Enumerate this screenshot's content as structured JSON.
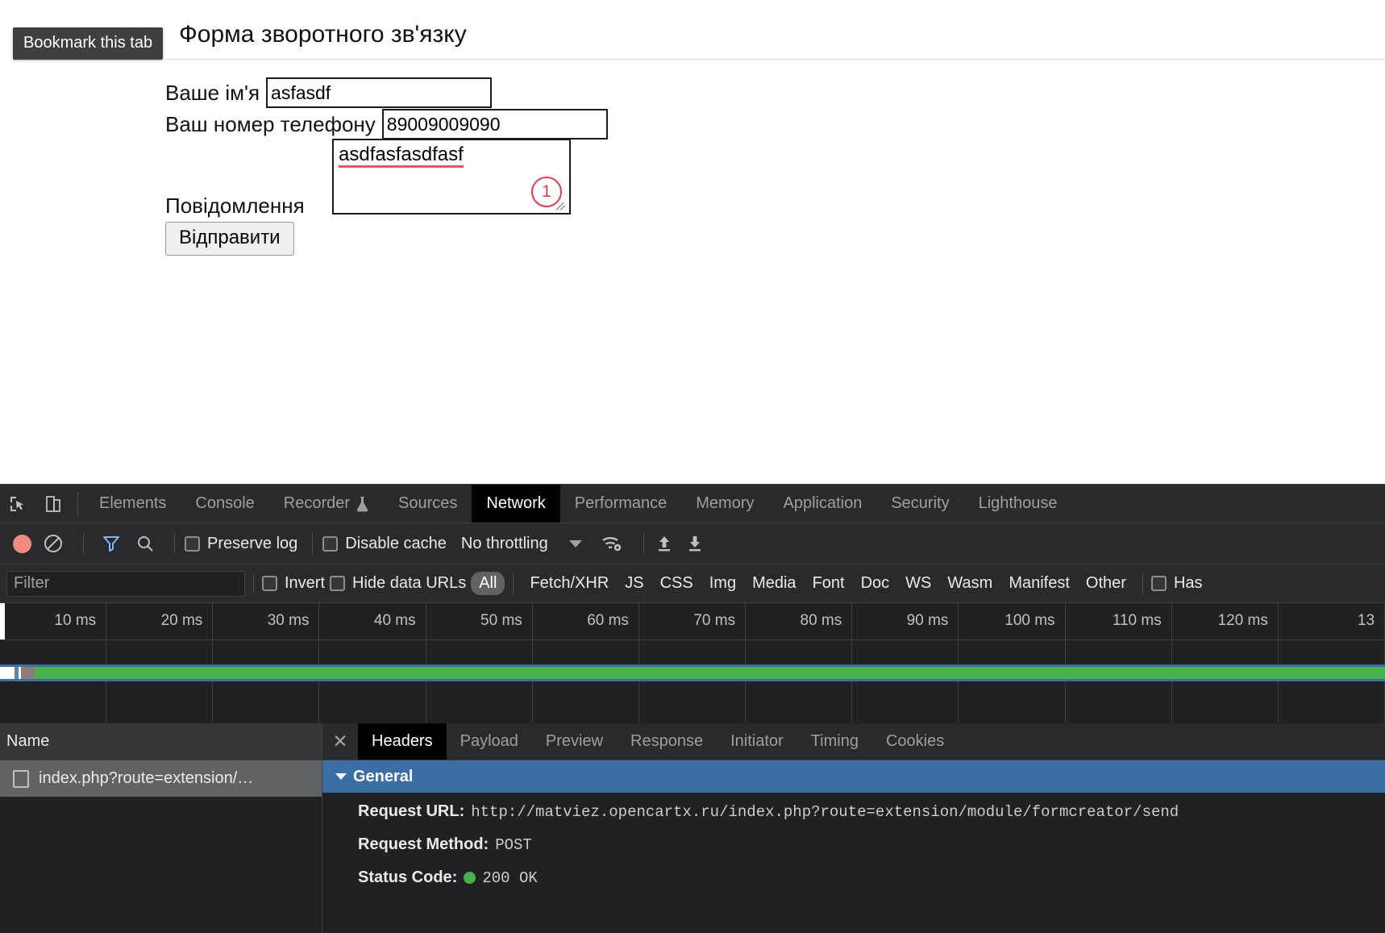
{
  "browser": {
    "tooltip": "Bookmark this tab"
  },
  "page": {
    "title": "Форма зворотного зв'язку",
    "fields": [
      {
        "label": "Ваше ім'я",
        "value": "asfasdf"
      },
      {
        "label": "Ваш номер телефону",
        "value": "89009009090"
      },
      {
        "label": "Повідомлення",
        "value": "asdfasfasdfasf"
      }
    ],
    "submit_label": "Відправити",
    "annotation_badge": "1",
    "annotation_color": "#e03a4e"
  },
  "devtools": {
    "tabs": [
      {
        "label": "Elements",
        "active": false
      },
      {
        "label": "Console",
        "active": false
      },
      {
        "label": "Recorder",
        "active": false,
        "icon": "flask-icon"
      },
      {
        "label": "Sources",
        "active": false
      },
      {
        "label": "Network",
        "active": true
      },
      {
        "label": "Performance",
        "active": false
      },
      {
        "label": "Memory",
        "active": false
      },
      {
        "label": "Application",
        "active": false
      },
      {
        "label": "Security",
        "active": false
      },
      {
        "label": "Lighthouse",
        "active": false
      }
    ],
    "toolbar": {
      "record_icon": "record-icon",
      "clear_icon": "clear-icon",
      "filter_icon": "funnel-icon",
      "search_icon": "search-icon",
      "preserve_log_label": "Preserve log",
      "disable_cache_label": "Disable cache",
      "throttling_value": "No throttling",
      "wifi_icon": "wifi-settings-icon",
      "import_icon": "upload-icon",
      "export_icon": "download-icon"
    },
    "filterbar": {
      "filter_placeholder": "Filter",
      "filter_value": "",
      "invert_label": "Invert",
      "hide_data_urls_label": "Hide data URLs",
      "resource_types": [
        "All",
        "Fetch/XHR",
        "JS",
        "CSS",
        "Img",
        "Media",
        "Font",
        "Doc",
        "WS",
        "Wasm",
        "Manifest",
        "Other"
      ],
      "selected_resource_type": "All",
      "has_blocked_label": "Has"
    },
    "timeline": {
      "ticks": [
        "10 ms",
        "20 ms",
        "30 ms",
        "40 ms",
        "50 ms",
        "60 ms",
        "70 ms",
        "80 ms",
        "90 ms",
        "100 ms",
        "110 ms",
        "120 ms",
        "13"
      ]
    },
    "requests_pane": {
      "column_header": "Name",
      "rows": [
        {
          "name": "index.php?route=extension/…"
        }
      ]
    },
    "details_pane": {
      "close_icon": "close-icon",
      "tabs": [
        {
          "label": "Headers",
          "active": true
        },
        {
          "label": "Payload",
          "active": false
        },
        {
          "label": "Preview",
          "active": false
        },
        {
          "label": "Response",
          "active": false
        },
        {
          "label": "Initiator",
          "active": false
        },
        {
          "label": "Timing",
          "active": false
        },
        {
          "label": "Cookies",
          "active": false
        }
      ],
      "general_section": {
        "title": "General",
        "items": [
          {
            "key": "Request URL:",
            "value": "http://matviez.opencartx.ru/index.php?route=extension/module/formcreator/send"
          },
          {
            "key": "Request Method:",
            "value": "POST"
          },
          {
            "key": "Status Code:",
            "value": "200 OK",
            "status_dot": "#4caf50"
          }
        ]
      }
    }
  }
}
